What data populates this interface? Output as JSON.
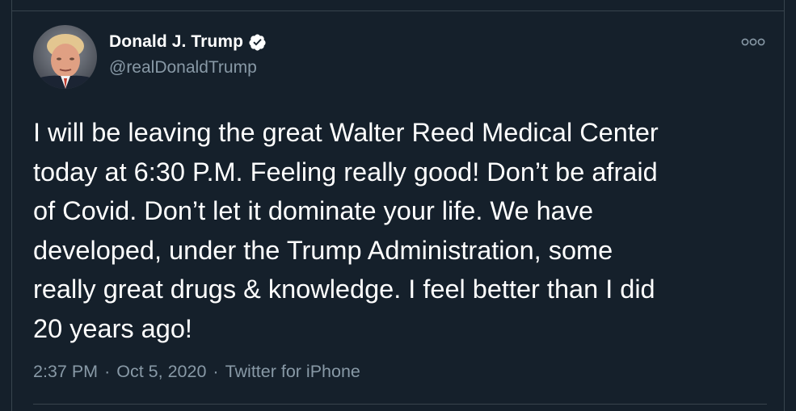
{
  "tweet": {
    "author": {
      "display_name": "Donald J. Trump",
      "handle": "@realDonaldTrump",
      "verified": true,
      "avatar_icon": "profile-photo"
    },
    "lines": [
      "I will be leaving the great Walter Reed Medical Center",
      "today at 6:30 P.M. Feeling really good! Don’t be afraid",
      "of Covid. Don’t let it dominate your life. We have",
      "developed, under the Trump Administration, some",
      "really great drugs & knowledge. I feel better than I did",
      "20 years ago!"
    ],
    "time": "2:37 PM",
    "separator": "·",
    "date": "Oct 5, 2020",
    "source": "Twitter for iPhone"
  },
  "icons": {
    "verified": "verified-badge-icon",
    "more": "more-options-icon"
  },
  "colors": {
    "background": "#15202b",
    "text_primary": "#ffffff",
    "text_secondary": "#8899a6",
    "border": "#38444d"
  }
}
